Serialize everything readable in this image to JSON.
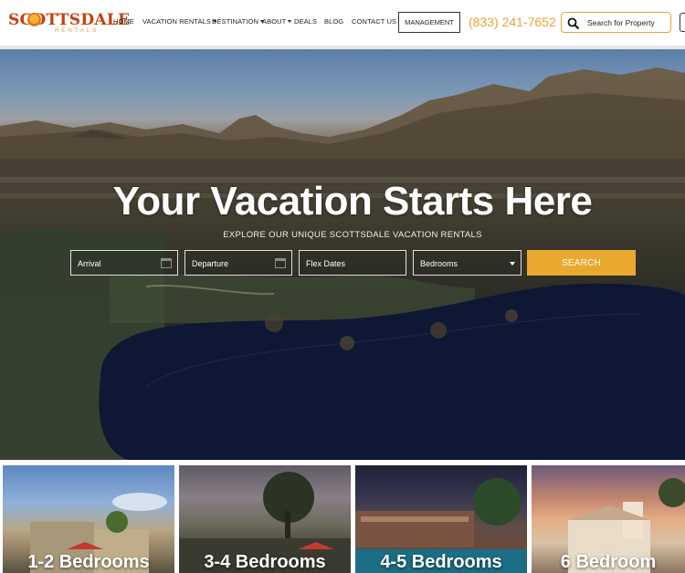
{
  "header": {
    "logo": {
      "wordmark": "SCOTTSDALE",
      "sub": "RENTALS"
    },
    "nav": [
      {
        "label": "HOME",
        "dropdown": false
      },
      {
        "label": "VACATION RENTALS",
        "dropdown": true
      },
      {
        "label": "DESTINATION",
        "dropdown": true
      },
      {
        "label": "ABOUT",
        "dropdown": true
      },
      {
        "label": "DEALS",
        "dropdown": false
      },
      {
        "label": "BLOG",
        "dropdown": false
      },
      {
        "label": "CONTACT US",
        "dropdown": true
      }
    ],
    "management_label": "MANAGEMENT",
    "phone": "(833) 241-7652",
    "search_label": "Search for Property"
  },
  "hero": {
    "title": "Your Vacation Starts Here",
    "subtitle": "EXPLORE OUR UNIQUE SCOTTSDALE VACATION RENTALS",
    "fields": {
      "arrival": "Arrival",
      "departure": "Departure",
      "flex": "Flex Dates",
      "bedrooms": "Bedrooms"
    },
    "search_button": "SEARCH"
  },
  "tiles": [
    {
      "label": "1-2 Bedrooms"
    },
    {
      "label": "3-4 Bedrooms"
    },
    {
      "label": "4-5 Bedrooms"
    },
    {
      "label": "6 Bedroom"
    }
  ],
  "colors": {
    "brand": "#c2410c",
    "accent": "#e8a233",
    "button": "#e9a92f"
  }
}
